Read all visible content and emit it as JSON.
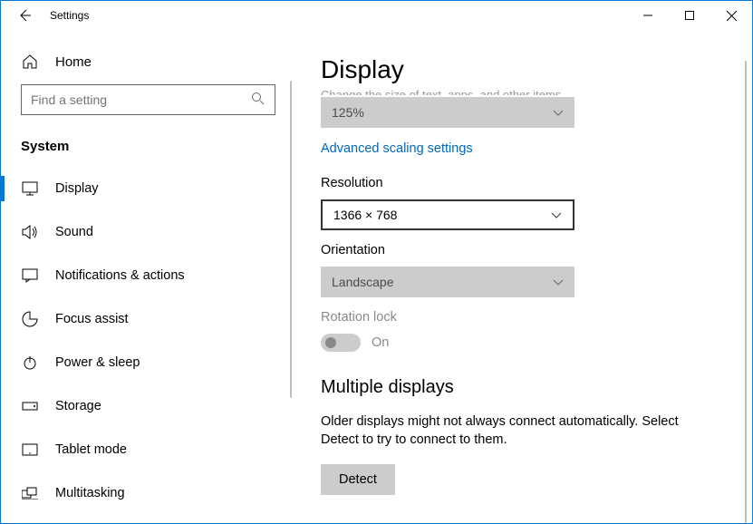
{
  "window": {
    "title": "Settings"
  },
  "sidebar": {
    "home": "Home",
    "search_placeholder": "Find a setting",
    "section": "System",
    "items": [
      {
        "label": "Display"
      },
      {
        "label": "Sound"
      },
      {
        "label": "Notifications & actions"
      },
      {
        "label": "Focus assist"
      },
      {
        "label": "Power & sleep"
      },
      {
        "label": "Storage"
      },
      {
        "label": "Tablet mode"
      },
      {
        "label": "Multitasking"
      }
    ]
  },
  "main": {
    "title": "Display",
    "scale": {
      "value": "125%"
    },
    "advanced_link": "Advanced scaling settings",
    "resolution": {
      "label": "Resolution",
      "value": "1366 × 768"
    },
    "orientation": {
      "label": "Orientation",
      "value": "Landscape"
    },
    "rotation_lock": {
      "label": "Rotation lock",
      "state": "On"
    },
    "multiple": {
      "heading": "Multiple displays",
      "text": "Older displays might not always connect automatically. Select Detect to try to connect to them.",
      "button": "Detect"
    }
  }
}
